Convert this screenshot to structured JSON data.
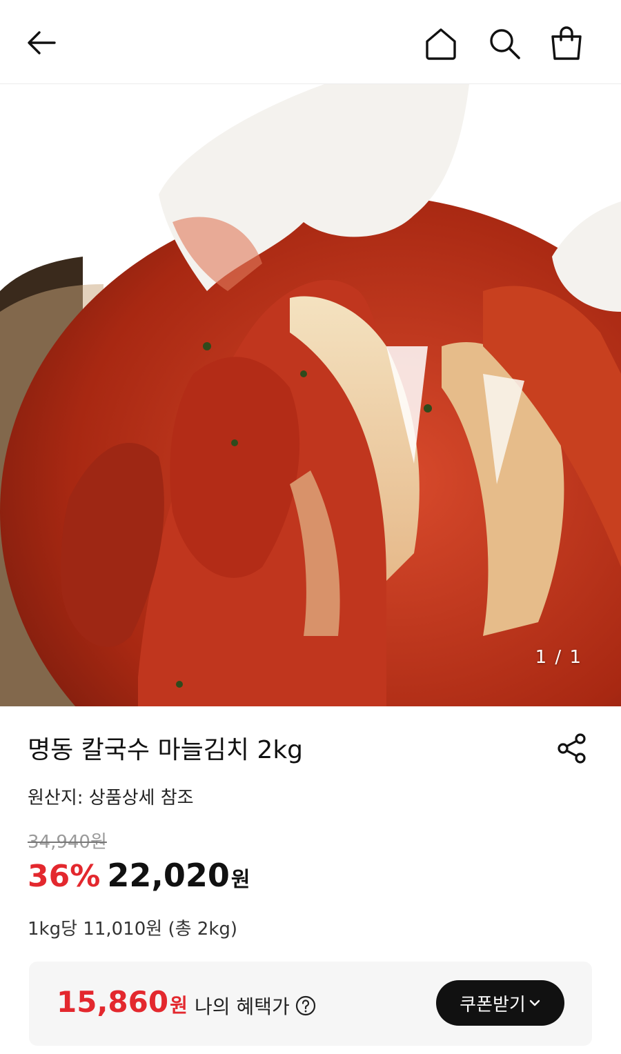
{
  "header": {
    "back_icon": "arrow-left-icon",
    "home_icon": "home-icon",
    "search_icon": "search-icon",
    "cart_icon": "shopping-bag-icon"
  },
  "hero": {
    "image": "kimchi-photo",
    "indicator": "1 / 1"
  },
  "product": {
    "title": "명동 칼국수 마늘김치 2kg",
    "share_icon": "share-icon",
    "origin": "원산지: 상품상세 참조",
    "original_price": "34,940원",
    "discount": "36%",
    "price": "22,020",
    "price_unit": "원",
    "unit_price": "1kg당 11,010원 (총 2kg)"
  },
  "benefit": {
    "price": "15,860",
    "price_unit": "원",
    "label": "나의 혜택가",
    "help_icon": "question-circle-icon",
    "coupon_label": "쿠폰받기",
    "coupon_icon": "chevron-down-icon"
  },
  "colors": {
    "accent_red": "#e3282e",
    "button_black": "#111111",
    "box_bg": "#f6f6f6"
  }
}
